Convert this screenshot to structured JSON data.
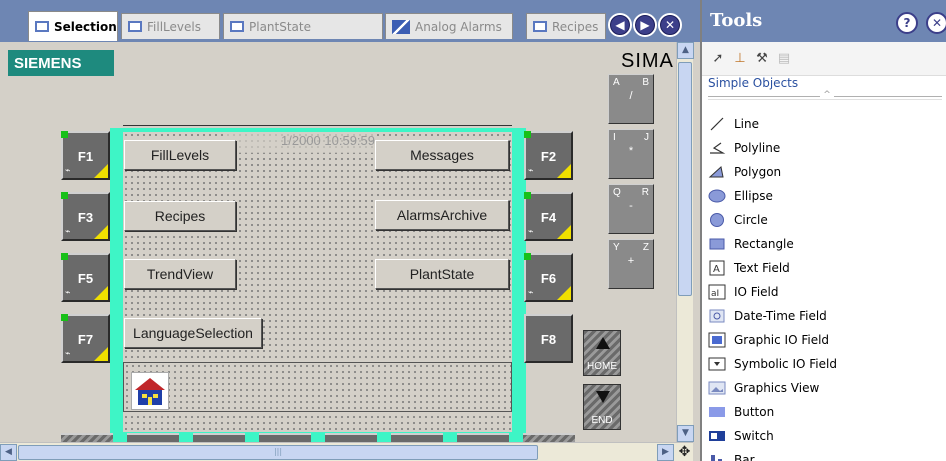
{
  "tabs": [
    {
      "label": "Selection",
      "active": true
    },
    {
      "label": "FillLevels",
      "active": false
    },
    {
      "label": "PlantState",
      "active": false
    },
    {
      "label": "Analog Alarms",
      "active": false
    },
    {
      "label": "Recipes",
      "active": false
    }
  ],
  "tab_nav": {
    "prev_icon": "◀",
    "next_icon": "▶",
    "close_icon": "✕"
  },
  "screen": {
    "brand": "SIEMENS",
    "title_fragment": "SIMA",
    "clock": "1/2000 10:59:59",
    "function_keys": [
      "F1",
      "F2",
      "F3",
      "F4",
      "F5",
      "F6",
      "F7",
      "F8"
    ],
    "buttons": [
      "FillLevels",
      "Messages",
      "Recipes",
      "AlarmsArchive",
      "TrendView",
      "PlantState",
      "LanguageSelection"
    ],
    "keypads": [
      {
        "left": "A",
        "right": "B",
        "center": "/"
      },
      {
        "left": "I",
        "right": "J",
        "center": "*"
      },
      {
        "left": "Q",
        "right": "R",
        "center": "-"
      },
      {
        "left": "Y",
        "right": "Z",
        "center": "+"
      }
    ],
    "nav_keys": [
      {
        "label": "HOME",
        "icon": "arrow-up"
      },
      {
        "label": "END",
        "icon": "arrow-down"
      }
    ]
  },
  "tools": {
    "title": "Tools",
    "help_icon": "?",
    "close_icon": "✕",
    "toolbar_icons": [
      "pointer-icon",
      "stamp-icon",
      "wrench-icon",
      "library-icon"
    ],
    "group": "Simple Objects",
    "items": [
      {
        "label": "Line",
        "icon": "line-icon"
      },
      {
        "label": "Polyline",
        "icon": "polyline-icon"
      },
      {
        "label": "Polygon",
        "icon": "polygon-icon"
      },
      {
        "label": "Ellipse",
        "icon": "ellipse-icon"
      },
      {
        "label": "Circle",
        "icon": "circle-icon"
      },
      {
        "label": "Rectangle",
        "icon": "rectangle-icon"
      },
      {
        "label": "Text Field",
        "icon": "text-field-icon"
      },
      {
        "label": "IO Field",
        "icon": "io-field-icon"
      },
      {
        "label": "Date-Time Field",
        "icon": "date-time-field-icon"
      },
      {
        "label": "Graphic IO Field",
        "icon": "graphic-io-field-icon"
      },
      {
        "label": "Symbolic IO Field",
        "icon": "symbolic-io-field-icon"
      },
      {
        "label": "Graphics View",
        "icon": "graphics-view-icon"
      },
      {
        "label": "Button",
        "icon": "button-icon"
      },
      {
        "label": "Switch",
        "icon": "switch-icon"
      },
      {
        "label": "Bar",
        "icon": "bar-icon"
      }
    ]
  },
  "colors": {
    "title_bar": "#6e86b3",
    "brand_bg": "#1e8a7e",
    "panel_accent": "#3ef5c6",
    "function_key": "#6a6a6a"
  }
}
